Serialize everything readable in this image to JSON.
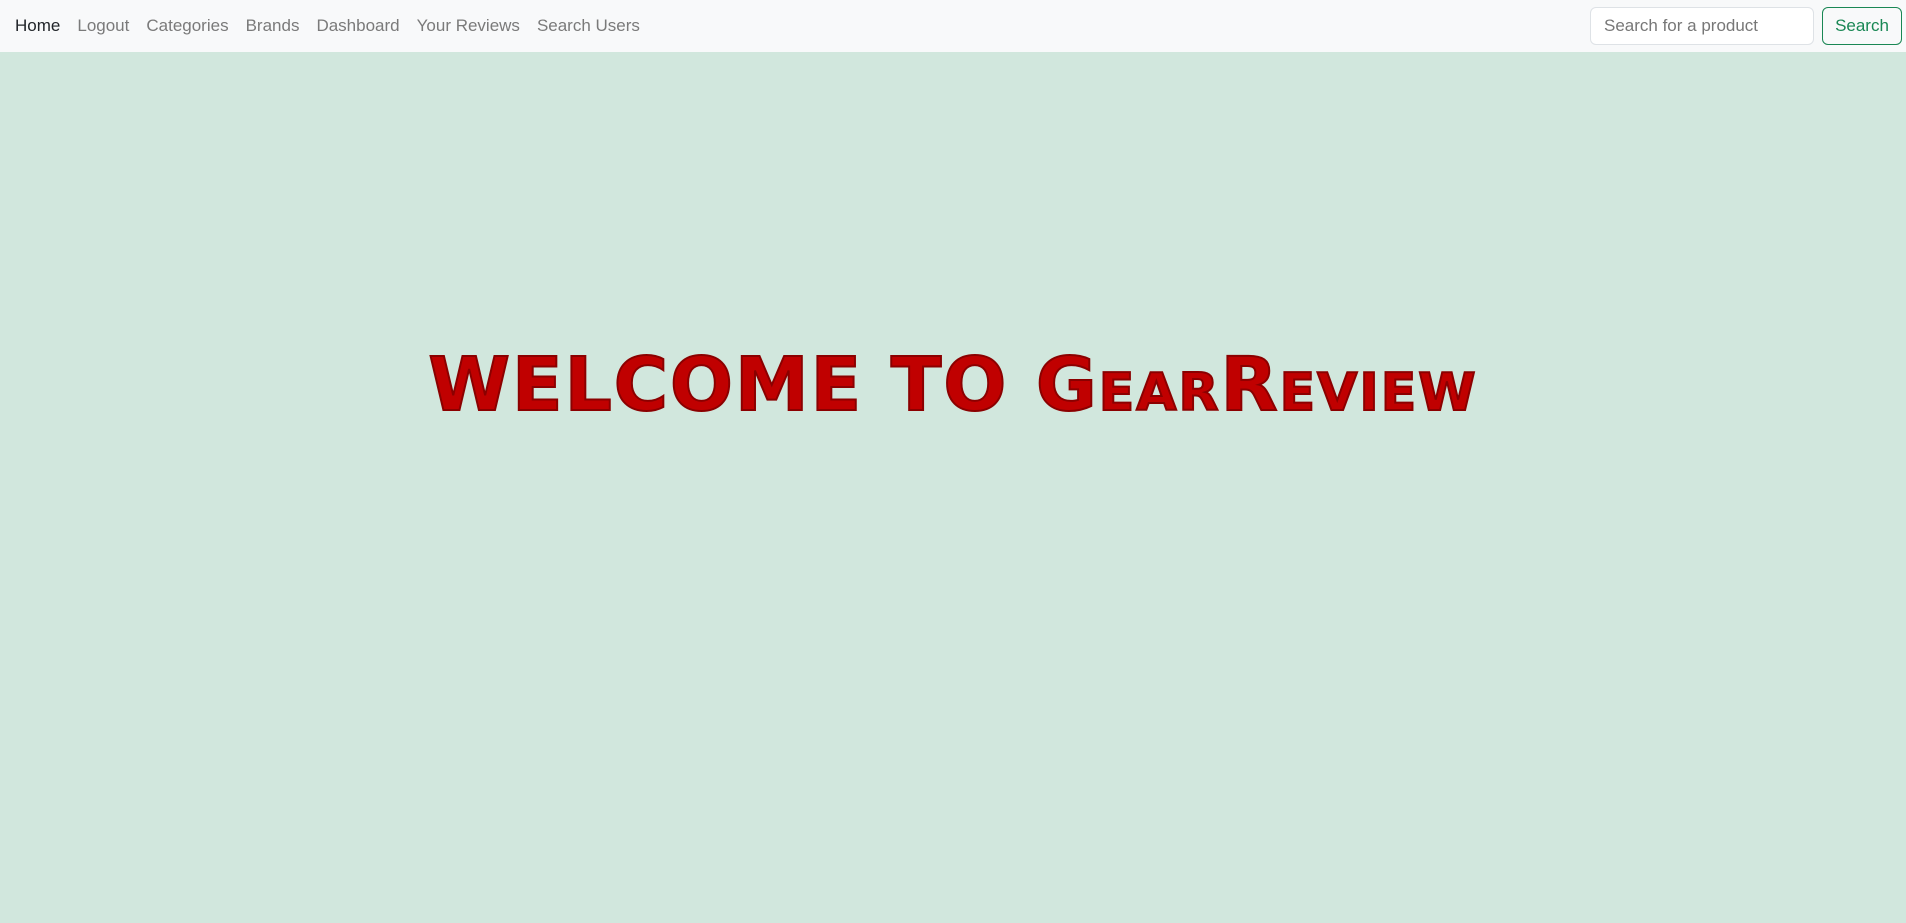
{
  "navbar": {
    "links": [
      {
        "label": "Home",
        "active": true
      },
      {
        "label": "Logout"
      },
      {
        "label": "Categories"
      },
      {
        "label": "Brands"
      },
      {
        "label": "Dashboard"
      },
      {
        "label": "Your Reviews"
      },
      {
        "label": "Search Users"
      }
    ],
    "search": {
      "placeholder": "Search for a product",
      "value": "",
      "button_label": "Search"
    }
  },
  "hero": {
    "title": "WELCOME TO GearReview"
  },
  "colors": {
    "navbar_bg": "#f8f9fa",
    "page_bg": "#d1e7dd",
    "accent_green": "#198754",
    "title_red": "#c00000"
  }
}
